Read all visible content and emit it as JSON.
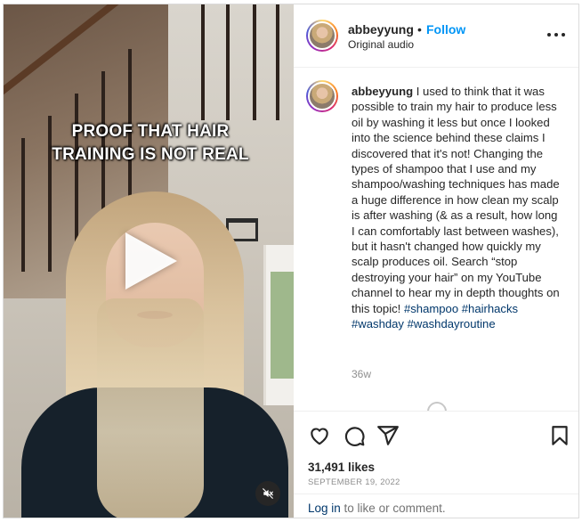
{
  "video": {
    "caption_line1": "PROOF THAT HAIR",
    "caption_line2": "TRAINING IS NOT REAL"
  },
  "header": {
    "username": "abbeyyung",
    "separator": "•",
    "follow_label": "Follow",
    "audio_label": "Original audio"
  },
  "post": {
    "username": "abbeyyung",
    "caption": "I used to think that it was possible to train my hair to produce less oil by washing it less but once I looked into the science behind these claims I discovered that it's not! Changing the types of shampoo that I use and my shampoo/washing techniques has made a huge difference in how clean my scalp is after washing (& as a result, how long I can comfortably last between washes), but it hasn't changed how quickly my scalp produces oil. Search “stop destroying your hair” on my YouTube channel to hear my in depth thoughts on this topic!",
    "hashtags": [
      "#shampoo",
      "#hairhacks",
      "#washday",
      "#washdayroutine"
    ],
    "time_ago": "36w"
  },
  "actions": {
    "likes": "31,491 likes",
    "date": "SEPTEMBER 19, 2022"
  },
  "login_bar": {
    "link_label": "Log in",
    "rest_text": " to like or comment."
  },
  "icons": {
    "heart": "heart-icon",
    "comment": "comment-icon",
    "share": "share-icon",
    "save": "bookmark-icon",
    "more": "more-options-icon",
    "play": "play-icon",
    "mute": "muted-speaker-icon"
  },
  "colors": {
    "follow_blue": "#0095f6",
    "link_navy": "#00376b",
    "muted_text": "#8e8e8e",
    "story_ring": "#d62976"
  }
}
